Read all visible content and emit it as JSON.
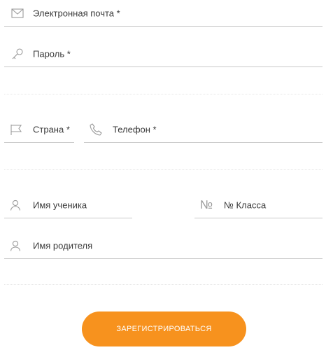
{
  "form": {
    "email": {
      "label": "Электронная почта *",
      "icon": "envelope-icon"
    },
    "password": {
      "label": "Пароль *",
      "icon": "key-icon"
    },
    "country": {
      "label": "Страна *",
      "icon": "flag-icon"
    },
    "phone": {
      "label": "Телефон *",
      "icon": "phone-icon"
    },
    "student_name": {
      "label": "Имя ученика",
      "icon": "user-icon"
    },
    "class_number": {
      "label": "№ Класса",
      "icon": "number-sign-icon",
      "glyph": "№"
    },
    "parent_name": {
      "label": "Имя родителя",
      "icon": "user-icon"
    },
    "submit_label": "ЗАРЕГИСТРИРОВАТЬСЯ"
  },
  "colors": {
    "accent": "#f7921e",
    "text": "#3a3a3a",
    "icon": "#9a9a9a",
    "underline": "#c9c9c9"
  }
}
